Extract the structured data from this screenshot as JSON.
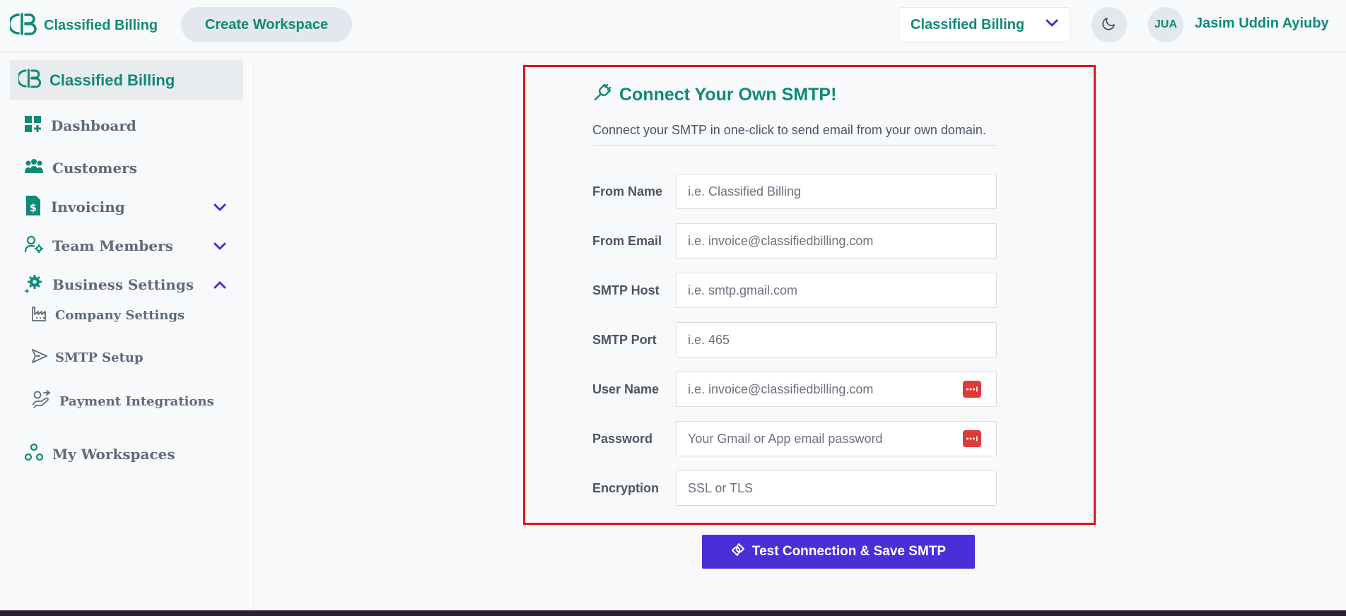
{
  "header": {
    "brand_name": "Classified Billing",
    "create_workspace_label": "Create Workspace",
    "workspace_select": "Classified Billing",
    "avatar_initials": "JUA",
    "user_name": "Jasim Uddin Ayiuby"
  },
  "sidebar": {
    "brand_label": "Classified Billing",
    "items": [
      {
        "label": "Dashboard",
        "icon": "dashboard-icon"
      },
      {
        "label": "Customers",
        "icon": "customers-icon"
      },
      {
        "label": "Invoicing",
        "icon": "invoice-icon"
      },
      {
        "label": "Team Members",
        "icon": "team-icon"
      },
      {
        "label": "Business Settings",
        "icon": "settings-gear-icon"
      },
      {
        "label": "My Workspaces",
        "icon": "workspaces-icon"
      }
    ],
    "sub_items": [
      {
        "label": "Company Settings",
        "icon": "factory-icon"
      },
      {
        "label": "SMTP Setup",
        "icon": "send-icon"
      },
      {
        "label": "Payment Integrations",
        "icon": "payment-hand-icon"
      }
    ]
  },
  "form": {
    "title": "Connect Your Own SMTP!",
    "subtitle": "Connect your SMTP in one-click to send email from your own domain.",
    "fields": [
      {
        "label": "From Name",
        "placeholder": "i.e. Classified Billing"
      },
      {
        "label": "From Email",
        "placeholder": "i.e. invoice@classifiedbilling.com"
      },
      {
        "label": "SMTP Host",
        "placeholder": "i.e. smtp.gmail.com"
      },
      {
        "label": "SMTP Port",
        "placeholder": "i.e. 465"
      },
      {
        "label": "User Name",
        "placeholder": "i.e. invoice@classifiedbilling.com"
      },
      {
        "label": "Password",
        "placeholder": "Your Gmail or App email password"
      },
      {
        "label": "Encryption",
        "placeholder": "SSL or TLS"
      }
    ],
    "submit_label": "Test Connection & Save SMTP"
  },
  "colors": {
    "brand": "#0f8a78",
    "accent": "#4a2fd9",
    "highlight_border": "#e3131b",
    "password_badge": "#e03a3a"
  }
}
